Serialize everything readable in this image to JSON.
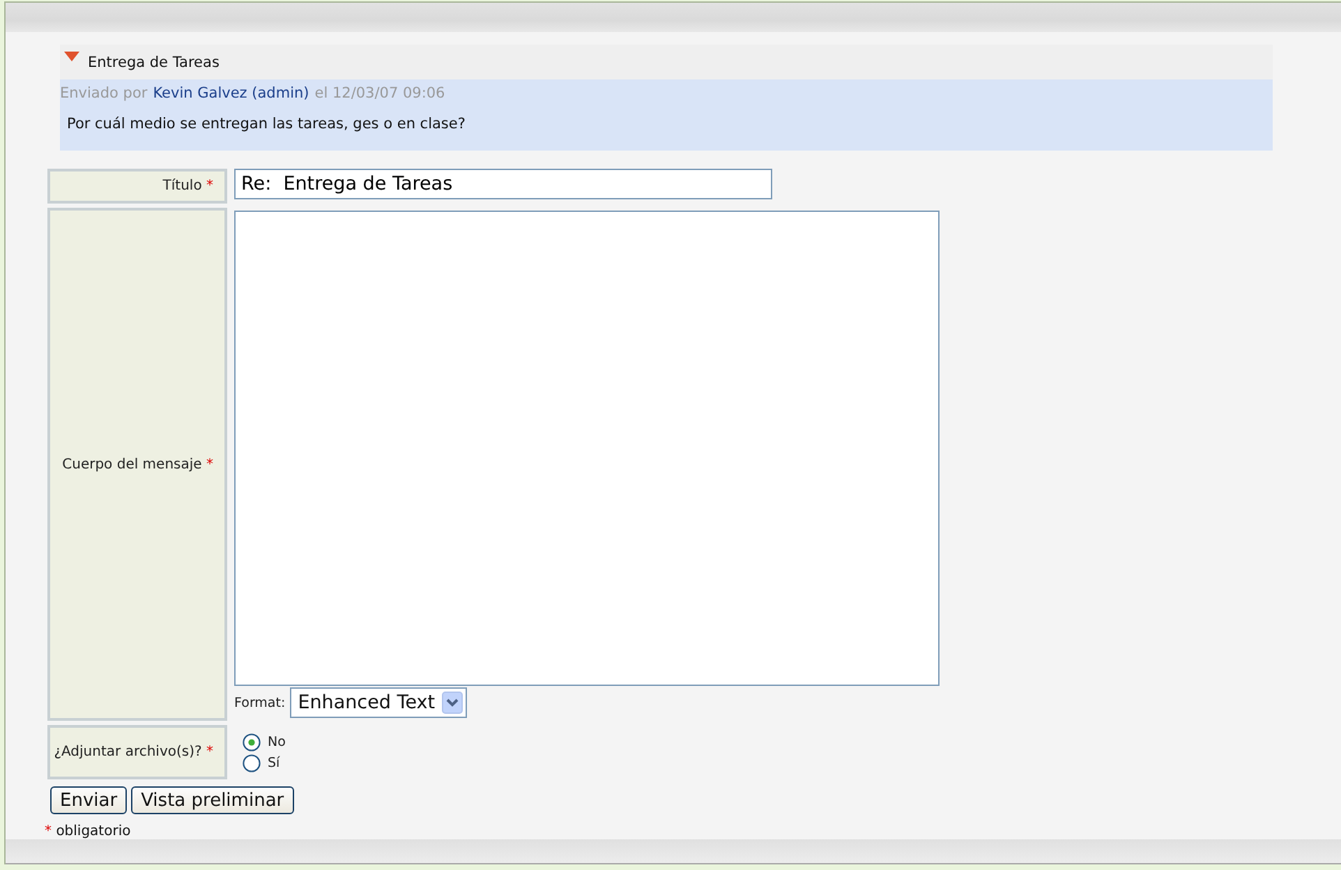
{
  "post": {
    "expanded": true,
    "subject": "Entrega de Tareas",
    "byline": {
      "prefix": "Enviado por",
      "author": "Kevin Galvez (admin)",
      "date": "el 12/03/07 09:06"
    },
    "message": "Por cuál medio se entregan las tareas, ges o en clase?"
  },
  "form": {
    "rows": [
      {
        "kind": "text",
        "label": "Título",
        "required_mark": "*",
        "value": "Re:  Entrega de Tareas"
      },
      {
        "kind": "textarea",
        "label": "Cuerpo del mensaje",
        "required_mark": "*",
        "format_label": "Format:",
        "format_value": "Enhanced Text"
      },
      {
        "kind": "radio",
        "label": "¿Adjuntar archivo(s)?",
        "required_mark": "*",
        "options": [
          {
            "label": "No",
            "selected": true
          },
          {
            "label": "Sí",
            "selected": false
          }
        ]
      }
    ],
    "buttons": [
      "Enviar",
      "Vista preliminar"
    ],
    "footnote": {
      "mark": "*",
      "text": "obligatorio"
    }
  }
}
